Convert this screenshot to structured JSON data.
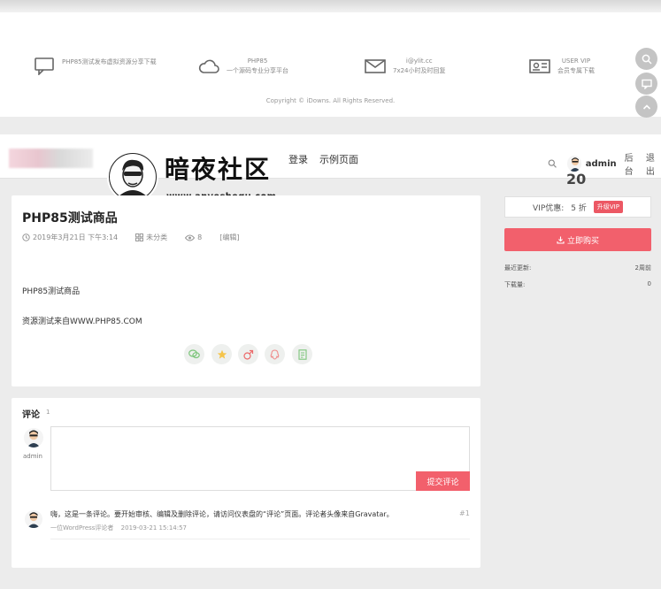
{
  "footer": {
    "features": [
      {
        "icon": "chat-icon",
        "line1": "PHP85测试发布虚拟资源分享下载",
        "line2": ""
      },
      {
        "icon": "cloud-icon",
        "line1": "PHP85",
        "line2": "一个源码专业分享平台"
      },
      {
        "icon": "mail-icon",
        "line1": "i@ylit.cc",
        "line2": "7x24小时及时回复"
      },
      {
        "icon": "vip-card-icon",
        "line1": "USER VIP",
        "line2": "会员专属下载"
      }
    ],
    "copyright": "Copyright © iDowns. All Rights Reserved."
  },
  "float_buttons": [
    "search-icon",
    "feedback-icon",
    "back-to-top-icon"
  ],
  "nav": {
    "links": [
      "登录",
      "示例页面"
    ],
    "user": "admin",
    "backend": "后台",
    "logout": "退出"
  },
  "watermark": {
    "title": "暗夜社区",
    "url": "www.anyeshequ.com"
  },
  "sidebar": {
    "price": "20",
    "vip_label": "VIP优惠:",
    "vip_discount": "5 折",
    "vip_upgrade": "升级VIP",
    "buy_button": "立即购买",
    "last_update_label": "最近更新:",
    "last_update_value": "2周前",
    "downloads_label": "下载量:",
    "downloads_value": "0"
  },
  "post": {
    "title": "PHP85测试商品",
    "date": "2019年3月21日 下午3:14",
    "category": "未分类",
    "views": "8",
    "edit": "[编辑]",
    "body": [
      "PHP85测试商品",
      "资源测试来自WWW.PHP85.COM"
    ],
    "share_icons": [
      "wechat-icon",
      "qzone-icon",
      "weibo-icon",
      "qq-icon",
      "poster-icon"
    ]
  },
  "comments": {
    "heading": "评论",
    "count": "1",
    "user_name": "admin",
    "submit": "提交评论",
    "items": [
      {
        "text": "嗨，这是一条评论。要开始审核、编辑及删除评论，请访问仪表盘的“评论”页面。评论者头像来自Gravatar。",
        "author": "一位WordPress评论者",
        "time": "2019-03-21 15:14:57",
        "number": "#1"
      }
    ]
  },
  "colors": {
    "accent": "#f2606c",
    "page_bg": "#ececec"
  }
}
